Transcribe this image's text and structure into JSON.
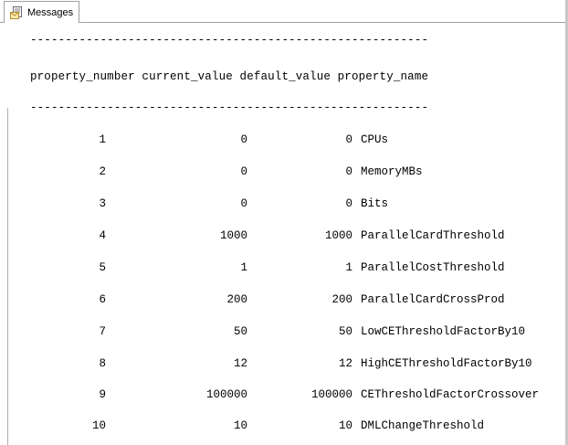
{
  "tab": {
    "label": "Messages",
    "icon": "messages-icon"
  },
  "output": {
    "separator_top": "---------------------------------------------------------",
    "header": "property_number current_value default_value property_name",
    "separator_bottom": "---------------------------------------------------------",
    "rows": [
      {
        "property_number": "1",
        "current_value": "0",
        "default_value": "0",
        "property_name": "CPUs"
      },
      {
        "property_number": "2",
        "current_value": "0",
        "default_value": "0",
        "property_name": "MemoryMBs"
      },
      {
        "property_number": "3",
        "current_value": "0",
        "default_value": "0",
        "property_name": "Bits"
      },
      {
        "property_number": "4",
        "current_value": "1000",
        "default_value": "1000",
        "property_name": "ParallelCardThreshold"
      },
      {
        "property_number": "5",
        "current_value": "1",
        "default_value": "1",
        "property_name": "ParallelCostThreshold"
      },
      {
        "property_number": "6",
        "current_value": "200",
        "default_value": "200",
        "property_name": "ParallelCardCrossProd"
      },
      {
        "property_number": "7",
        "current_value": "50",
        "default_value": "50",
        "property_name": "LowCEThresholdFactorBy10"
      },
      {
        "property_number": "8",
        "current_value": "12",
        "default_value": "12",
        "property_name": "HighCEThresholdFactorBy10"
      },
      {
        "property_number": "9",
        "current_value": "100000",
        "default_value": "100000",
        "property_name": "CEThresholdFactorCrossover"
      },
      {
        "property_number": "10",
        "current_value": "10",
        "default_value": "10",
        "property_name": "DMLChangeThreshold"
      }
    ]
  }
}
